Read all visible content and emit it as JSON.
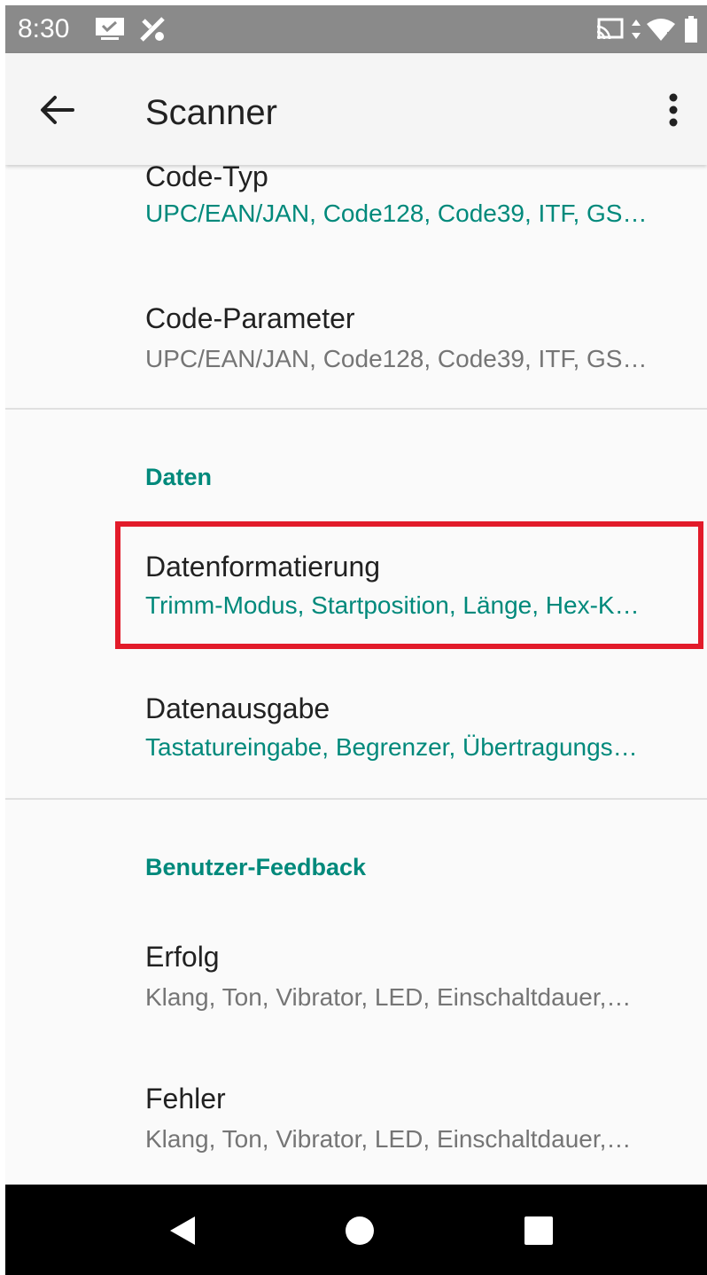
{
  "status_bar": {
    "time": "8:30",
    "icons": [
      "screen-icon",
      "tools-icon",
      "cast-icon",
      "data-arrows-icon",
      "wifi-icon",
      "battery-icon"
    ]
  },
  "app_bar": {
    "title": "Scanner",
    "back_icon": "arrow-back-icon",
    "menu_icon": "more-vert-icon"
  },
  "items": {
    "code_typ": {
      "title": "Code-Typ",
      "summary": "UPC/EAN/JAN, Code128, Code39, ITF, GS…"
    },
    "code_parameter": {
      "title": "Code-Parameter",
      "summary": "UPC/EAN/JAN, Code128, Code39, ITF, GS…"
    },
    "daten_category": "Daten",
    "datenformatierung": {
      "title": "Datenformatierung",
      "summary": "Trimm-Modus, Startposition, Länge, Hex-K…"
    },
    "datenausgabe": {
      "title": "Datenausgabe",
      "summary": "Tastatureingabe, Begrenzer, Übertragungs…"
    },
    "feedback_category": "Benutzer-Feedback",
    "erfolg": {
      "title": "Erfolg",
      "summary": "Klang, Ton, Vibrator, LED, Einschaltdauer,…"
    },
    "fehler": {
      "title": "Fehler",
      "summary": "Klang, Ton, Vibrator, LED, Einschaltdauer,…"
    }
  },
  "colors": {
    "accent": "#00897b",
    "highlight": "#e21b2a",
    "status_bar": "#8a8a8a",
    "nav_bar": "#000000"
  },
  "nav_bar": {
    "icons": [
      "back-triangle-icon",
      "home-circle-icon",
      "recents-square-icon"
    ]
  }
}
